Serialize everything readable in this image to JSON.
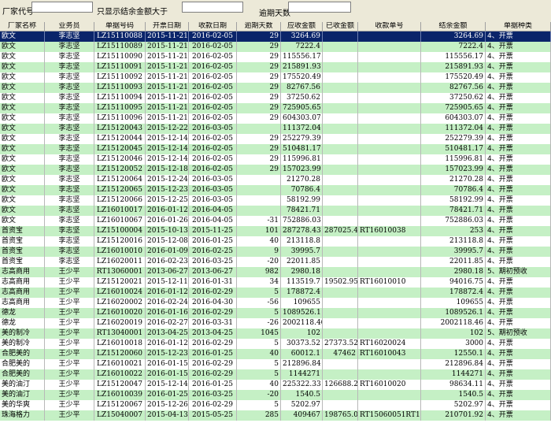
{
  "filters": {
    "vendor_code_label": "厂家代号",
    "min_amount_label": "只显示结余金额大于",
    "overdue_days_label": "逾期天数"
  },
  "columns": [
    "厂家名称",
    "业务员",
    "单据号码",
    "开票日期",
    "收款日期",
    "逾期天数",
    "应收金额",
    "已收金额",
    "收款单号",
    "结余金额",
    "单据种类"
  ],
  "rows": [
    [
      "欧文",
      "李志坚",
      "LZ15110088",
      "2015-11-21",
      "2016-02-05",
      "29",
      "3264.69",
      "",
      "",
      "3264.69",
      "4、开票"
    ],
    [
      "欧文",
      "李志坚",
      "LZ15110089",
      "2015-11-21",
      "2016-02-05",
      "29",
      "7222.4",
      "",
      "",
      "7222.4",
      "4、开票"
    ],
    [
      "欧文",
      "李志坚",
      "LZ15110090",
      "2015-11-21",
      "2016-02-05",
      "29",
      "115556.17",
      "",
      "",
      "115556.17",
      "4、开票"
    ],
    [
      "欧文",
      "李志坚",
      "LZ15110091",
      "2015-11-21",
      "2016-02-05",
      "29",
      "215891.93",
      "",
      "",
      "215891.93",
      "4、开票"
    ],
    [
      "欧文",
      "李志坚",
      "LZ15110092",
      "2015-11-21",
      "2016-02-05",
      "29",
      "175520.49",
      "",
      "",
      "175520.49",
      "4、开票"
    ],
    [
      "欧文",
      "李志坚",
      "LZ15110093",
      "2015-11-21",
      "2016-02-05",
      "29",
      "82767.56",
      "",
      "",
      "82767.56",
      "4、开票"
    ],
    [
      "欧文",
      "李志坚",
      "LZ15110094",
      "2015-11-21",
      "2016-02-05",
      "29",
      "37250.62",
      "",
      "",
      "37250.62",
      "4、开票"
    ],
    [
      "欧文",
      "李志坚",
      "LZ15110095",
      "2015-11-21",
      "2016-02-05",
      "29",
      "725905.65",
      "",
      "",
      "725905.65",
      "4、开票"
    ],
    [
      "欧文",
      "李志坚",
      "LZ15110096",
      "2015-11-21",
      "2016-02-05",
      "29",
      "604303.07",
      "",
      "",
      "604303.07",
      "4、开票"
    ],
    [
      "欧文",
      "李志坚",
      "LZ15120043",
      "2015-12-22",
      "2016-03-05",
      "",
      "111372.04",
      "",
      "",
      "111372.04",
      "4、开票"
    ],
    [
      "欧文",
      "李志坚",
      "LZ15120044",
      "2015-12-14",
      "2016-02-05",
      "29",
      "252279.39",
      "",
      "",
      "252279.39",
      "4、开票"
    ],
    [
      "欧文",
      "李志坚",
      "LZ15120045",
      "2015-12-14",
      "2016-02-05",
      "29",
      "510481.17",
      "",
      "",
      "510481.17",
      "4、开票"
    ],
    [
      "欧文",
      "李志坚",
      "LZ15120046",
      "2015-12-14",
      "2016-02-05",
      "29",
      "115996.81",
      "",
      "",
      "115996.81",
      "4、开票"
    ],
    [
      "欧文",
      "李志坚",
      "LZ15120052",
      "2015-12-18",
      "2016-02-05",
      "29",
      "157023.99",
      "",
      "",
      "157023.99",
      "4、开票"
    ],
    [
      "欧文",
      "李志坚",
      "LZ15120064",
      "2015-12-24",
      "2016-03-05",
      "",
      "21270.28",
      "",
      "",
      "21270.28",
      "4、开票"
    ],
    [
      "欧文",
      "李志坚",
      "LZ15120065",
      "2015-12-23",
      "2016-03-05",
      "",
      "70786.4",
      "",
      "",
      "70786.4",
      "4、开票"
    ],
    [
      "欧文",
      "李志坚",
      "LZ15120066",
      "2015-12-25",
      "2016-03-05",
      "",
      "58192.99",
      "",
      "",
      "58192.99",
      "4、开票"
    ],
    [
      "欧文",
      "李志坚",
      "LZ16010017",
      "2016-01-12",
      "2016-04-05",
      "",
      "78421.71",
      "",
      "",
      "78421.71",
      "4、开票"
    ],
    [
      "欧文",
      "李志坚",
      "LZ16010067",
      "2016-01-26",
      "2016-04-05",
      "-31",
      "752886.03",
      "",
      "",
      "752886.03",
      "4、开票"
    ],
    [
      "首资宝",
      "李志坚",
      "LZ15100004",
      "2015-10-13",
      "2015-11-25",
      "101",
      "287278.43",
      "287025.43",
      "RT16010038",
      "253",
      "4、开票"
    ],
    [
      "首资宝",
      "李志坚",
      "LZ15120016",
      "2015-12-08",
      "2016-01-25",
      "40",
      "213118.8",
      "",
      "",
      "213118.8",
      "4、开票"
    ],
    [
      "首资宝",
      "李志坚",
      "LZ16010010",
      "2016-01-09",
      "2016-02-25",
      "9",
      "39995.7",
      "",
      "",
      "39995.7",
      "4、开票"
    ],
    [
      "首资宝",
      "李志坚",
      "LZ16020011",
      "2016-02-23",
      "2016-03-25",
      "-20",
      "22011.85",
      "",
      "",
      "22011.85",
      "4、开票"
    ],
    [
      "志高商用",
      "王少平",
      "RT13060001",
      "2013-06-27",
      "2013-06-27",
      "982",
      "2980.18",
      "",
      "",
      "2980.18",
      "5、期初预收"
    ],
    [
      "志高商用",
      "王少平",
      "LZ15120021",
      "2015-12-11",
      "2016-01-31",
      "34",
      "113519.7",
      "19502.95",
      "RT16010010",
      "94016.75",
      "4、开票"
    ],
    [
      "志高商用",
      "王少平",
      "LZ16010024",
      "2016-01-12",
      "2016-02-29",
      "5",
      "178872.4",
      "",
      "",
      "178872.4",
      "4、开票"
    ],
    [
      "志高商用",
      "王少平",
      "LZ16020002",
      "2016-02-24",
      "2016-04-30",
      "-56",
      "109655",
      "",
      "",
      "109655",
      "4、开票"
    ],
    [
      "德龙",
      "王少平",
      "LZ16010020",
      "2016-01-16",
      "2016-02-29",
      "5",
      "1089526.1",
      "",
      "",
      "1089526.1",
      "4、开票"
    ],
    [
      "德龙",
      "王少平",
      "LZ16020019",
      "2016-02-27",
      "2016-03-31",
      "-26",
      "2002118.46",
      "",
      "",
      "2002118.46",
      "4、开票"
    ],
    [
      "美的制冷",
      "王少平",
      "RT13040001",
      "2013-04-25",
      "2013-04-25",
      "1045",
      "102",
      "",
      "",
      "102",
      "5、期初预收"
    ],
    [
      "美的制冷",
      "王少平",
      "LZ16010018",
      "2016-01-12",
      "2016-02-29",
      "5",
      "30373.52",
      "27373.52",
      "RT16020024",
      "3000",
      "4、开票"
    ],
    [
      "合肥美的",
      "王少平",
      "LZ15120060",
      "2015-12-23",
      "2016-01-25",
      "40",
      "60012.1",
      "47462",
      "RT16010043",
      "12550.1",
      "4、开票"
    ],
    [
      "合肥美的",
      "王少平",
      "LZ16010021",
      "2016-01-15",
      "2016-02-29",
      "5",
      "212896.84",
      "",
      "",
      "212896.84",
      "4、开票"
    ],
    [
      "合肥美的",
      "王少平",
      "LZ16010022",
      "2016-01-15",
      "2016-02-29",
      "5",
      "1144271",
      "",
      "",
      "1144271",
      "4、开票"
    ],
    [
      "美的油汀",
      "王少平",
      "LZ15120047",
      "2015-12-14",
      "2016-01-25",
      "40",
      "225322.33",
      "126688.22",
      "RT16010020",
      "98634.11",
      "4、开票"
    ],
    [
      "美的油汀",
      "王少平",
      "LZ16010039",
      "2016-01-25",
      "2016-03-25",
      "-20",
      "1540.5",
      "",
      "",
      "1540.5",
      "4、开票"
    ],
    [
      "美的华爽",
      "王少平",
      "LZ15120067",
      "2015-12-26",
      "2016-02-29",
      "5",
      "5202.97",
      "",
      "",
      "5202.97",
      "4、开票"
    ],
    [
      "珠海格力",
      "王少平",
      "LZ15040007",
      "2015-04-13",
      "2015-05-25",
      "285",
      "409467",
      "198765.08",
      "RT15060051RT15...",
      "210701.92",
      "4、开票"
    ]
  ],
  "colors": {
    "window_bg": "#ece9d8",
    "row_alt": "#c5f0c5",
    "row_plain": "#ffffff",
    "selected": "#0a246a"
  }
}
